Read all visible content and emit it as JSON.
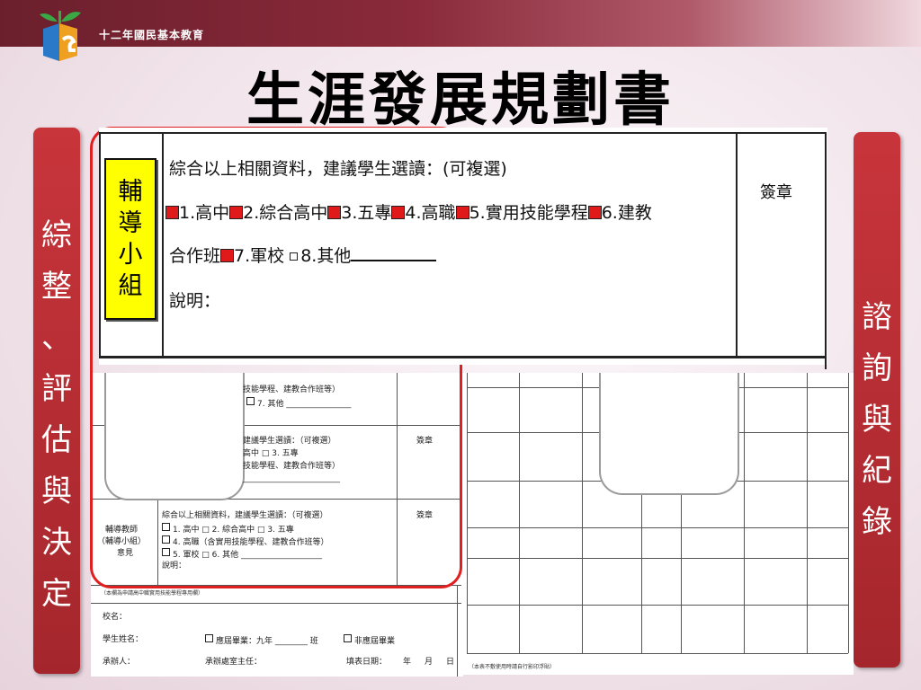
{
  "header": {
    "org": "十二年國民基本教育",
    "title": "生涯發展規劃書"
  },
  "left_banner": {
    "chars": [
      "綜",
      "整",
      "、",
      "評",
      "估",
      "與",
      "決",
      "定"
    ]
  },
  "right_banner": {
    "chars": [
      "諮",
      "詢",
      "與",
      "紀",
      "錄"
    ]
  },
  "zoom_table": {
    "side_label": [
      "輔",
      "導",
      "小",
      "組"
    ],
    "line1": "綜合以上相關資料，建議學生選讀：(可複選)",
    "options": [
      "1.高中",
      "2.綜合高中",
      "3.五專",
      "4.高職",
      "5.實用技能學程",
      "6.建教"
    ],
    "line3_a": "合作班",
    "line3_b": "7.軍校",
    "line3_c": "8.其他",
    "line4": "說明：",
    "sign": "簽章"
  },
  "doc_left": {
    "r1a": "技能學程、建教合作班等）",
    "r1b": "7. 其他",
    "r2a": "建議學生選讀：（可複選）",
    "r2b": "高中 □ 3. 五專",
    "r2c": "技能學程、建教合作班等）",
    "r2sign": "簽章",
    "counselor": [
      "輔導教師",
      "（輔導小組）",
      "意見"
    ],
    "r3a": "綜合以上相關資料，建議學生選讀：（可複選）",
    "r3b": "1. 高中 □ 2. 綜合高中 □ 3. 五專",
    "r3c": "4. 高職（含實用技能學程、建教合作班等）",
    "r3d": "5. 軍校 □ 6. 其他",
    "r3e": "說明：",
    "r3sign": "簽章",
    "note": "（本欄為申請高中職實用技能學程專用欄）",
    "school": "校名：",
    "student": "學生姓名：",
    "grad_current": "應屆畢業：九年",
    "class": "班",
    "grad_prior": "非應屆畢業",
    "handler": "承辦人：",
    "director": "承辦處室主任：",
    "date": "填表日期：",
    "year": "年",
    "month": "月",
    "day": "日"
  },
  "doc_right": {
    "note": "（本表不敷使用時請自行影印浮貼）"
  }
}
